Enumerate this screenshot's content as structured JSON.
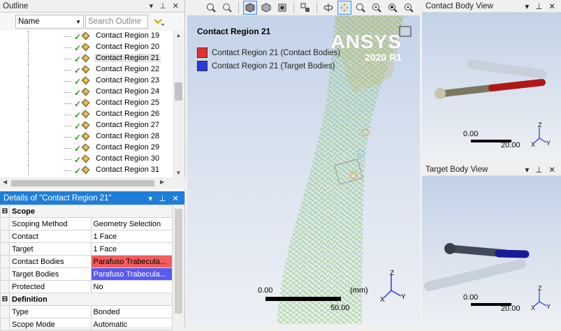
{
  "outline": {
    "title": "Outline",
    "filter_select": "Name",
    "search_placeholder": "Search Outline",
    "items": [
      {
        "label": "Contact Region 19"
      },
      {
        "label": "Contact Region 20"
      },
      {
        "label": "Contact Region 21"
      },
      {
        "label": "Contact Region 22"
      },
      {
        "label": "Contact Region 23"
      },
      {
        "label": "Contact Region 24"
      },
      {
        "label": "Contact Region 25"
      },
      {
        "label": "Contact Region 26"
      },
      {
        "label": "Contact Region 27"
      },
      {
        "label": "Contact Region 28"
      },
      {
        "label": "Contact Region 29"
      },
      {
        "label": "Contact Region 30"
      },
      {
        "label": "Contact Region 31"
      }
    ],
    "selected_index": 2
  },
  "details": {
    "title": "Details of \"Contact Region 21\"",
    "groups": [
      {
        "name": "Scope",
        "rows": [
          {
            "key": "Scoping Method",
            "value": "Geometry Selection"
          },
          {
            "key": "Contact",
            "value": "1 Face"
          },
          {
            "key": "Target",
            "value": "1 Face"
          },
          {
            "key": "Contact Bodies",
            "value": "Parafuso Trabecula...",
            "highlight": "#f25c5c"
          },
          {
            "key": "Target Bodies",
            "value": "Parafuso Trabecula...",
            "highlight": "#5a5af0"
          },
          {
            "key": "Protected",
            "value": "No"
          }
        ]
      },
      {
        "name": "Definition",
        "rows": [
          {
            "key": "Type",
            "value": "Bonded"
          },
          {
            "key": "Scope Mode",
            "value": "Automatic"
          }
        ]
      }
    ]
  },
  "viewport": {
    "title": "Contact Region 21",
    "legend": [
      {
        "label": "Contact Region 21 (Contact Bodies)",
        "color": "#e8302e"
      },
      {
        "label": "Contact Region 21 (Target Bodies)",
        "color": "#2a38e0"
      }
    ],
    "brand": "ANSYS",
    "version": "2020 R1",
    "scale_min": "0.00",
    "scale_max": "50.00",
    "scale_unit": "(mm)",
    "axis_labels": {
      "x": "X",
      "y": "Y",
      "z": "Z"
    }
  },
  "contact_view": {
    "title": "Contact Body View",
    "scale_min": "0.00",
    "scale_max": "20.00",
    "axis_labels": {
      "x": "X",
      "y": "Y",
      "z": "Z"
    }
  },
  "target_view": {
    "title": "Target Body View",
    "scale_min": "0.00",
    "scale_max": "20.00",
    "axis_labels": {
      "x": "X",
      "y": "Y",
      "z": "Z"
    }
  },
  "panel_controls": {
    "menu": "▾",
    "pin": "⊥",
    "close": "✕"
  },
  "toolbar_icons": [
    "zoom-in-icon",
    "zoom-out-icon",
    "iso-view-icon",
    "shaded-view-icon",
    "render-mode-icon",
    "select-mode-icon",
    "rotate-icon",
    "pan-icon",
    "zoom-box-icon",
    "zoom-fit-icon",
    "zoom-selection-icon",
    "magnifier-icon"
  ]
}
